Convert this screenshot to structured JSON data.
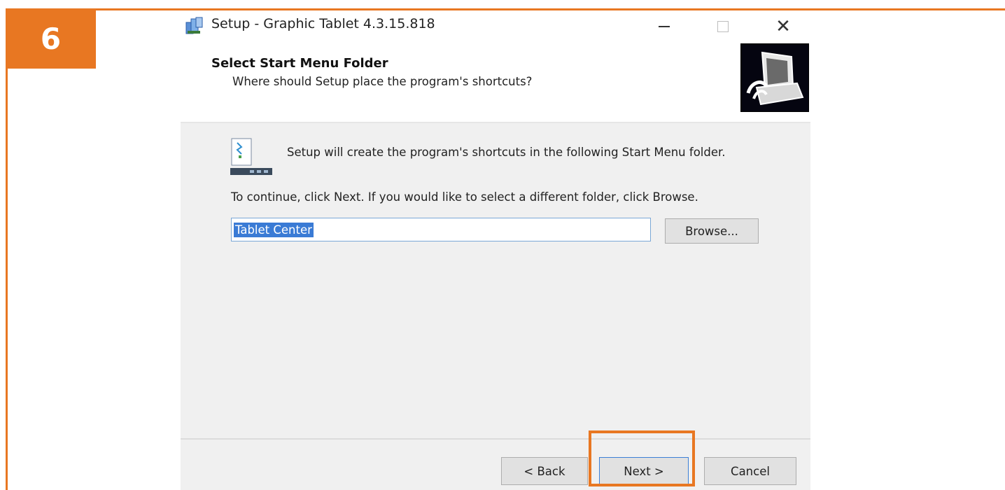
{
  "step_badge": "6",
  "window": {
    "title": "Setup - Graphic Tablet 4.3.15.818",
    "controls": {
      "minimize_icon": "minimize-icon",
      "maximize_icon": "maximize-icon",
      "close_glyph": "✕"
    }
  },
  "header": {
    "title": "Select Start Menu Folder",
    "subtitle": "Where should Setup place the program's shortcuts?"
  },
  "content": {
    "info_text": "Setup will create the program's shortcuts in the following Start Menu folder.",
    "instruction_text": "To continue, click Next. If you would like to select a different folder, click Browse.",
    "folder_value": "Tablet Center",
    "browse_label": "Browse..."
  },
  "footer": {
    "back_label": "< Back",
    "next_label": "Next >",
    "cancel_label": "Cancel"
  },
  "colors": {
    "accent": "#e87722",
    "selection": "#3a7bd5",
    "panel_bg": "#f0f0f0"
  }
}
